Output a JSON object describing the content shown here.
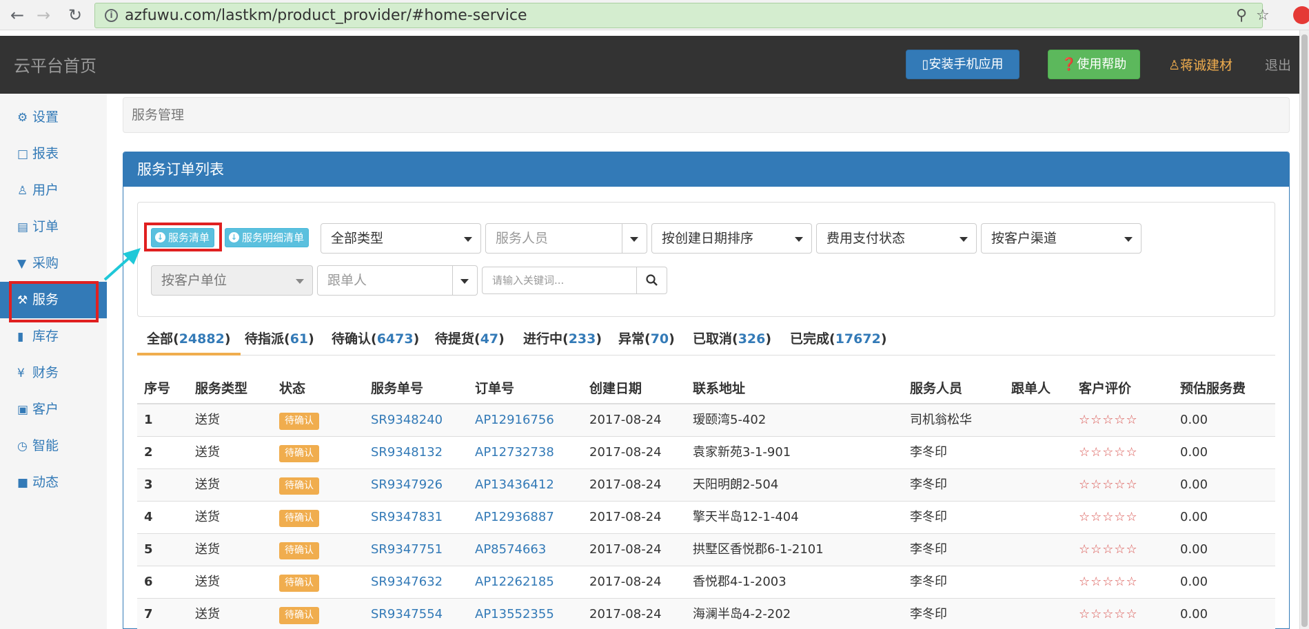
{
  "browser": {
    "url": "azfuwu.com/lastkm/product_provider/#home-service"
  },
  "header": {
    "brand": "云平台首页",
    "install_label": "安装手机应用",
    "help_label": "使用帮助",
    "user_name": "蒋诚建材",
    "logout_label": "退出"
  },
  "sidebar": {
    "items": [
      {
        "label": "设置",
        "icon": "gear-icon"
      },
      {
        "label": "报表",
        "icon": "bar-chart-icon"
      },
      {
        "label": "用户",
        "icon": "user-icon"
      },
      {
        "label": "订单",
        "icon": "list-icon"
      },
      {
        "label": "采购",
        "icon": "cart-icon"
      },
      {
        "label": "服务",
        "icon": "wrench-icon"
      },
      {
        "label": "库存",
        "icon": "barcode-icon"
      },
      {
        "label": "财务",
        "icon": "yen-icon"
      },
      {
        "label": "客户",
        "icon": "briefcase-icon"
      },
      {
        "label": "智能",
        "icon": "dashboard-icon"
      },
      {
        "label": "动态",
        "icon": "comment-icon"
      }
    ],
    "active_index": 5
  },
  "breadcrumb": "服务管理",
  "panel_title": "服务订单列表",
  "filters": {
    "btn_service_list": "服务清单",
    "btn_service_detail": "服务明细清单",
    "type": "全部类型",
    "staff": "服务人员",
    "sort": "按创建日期排序",
    "payment": "费用支付状态",
    "channel": "按客户渠道",
    "unit": "按客户单位",
    "follower": "跟单人",
    "keyword_placeholder": "请输入关键词..."
  },
  "tabs": [
    {
      "label": "全部",
      "count": "24882"
    },
    {
      "label": "待指派",
      "count": "61"
    },
    {
      "label": "待确认",
      "count": "6473"
    },
    {
      "label": "待提货",
      "count": "47"
    },
    {
      "label": "进行中",
      "count": "233"
    },
    {
      "label": "异常",
      "count": "70"
    },
    {
      "label": "已取消",
      "count": "326"
    },
    {
      "label": "已完成",
      "count": "17672"
    }
  ],
  "table": {
    "headers": [
      "序号",
      "服务类型",
      "状态",
      "服务单号",
      "订单号",
      "创建日期",
      "联系地址",
      "服务人员",
      "跟单人",
      "客户评价",
      "预估服务费"
    ],
    "rows": [
      {
        "no": "1",
        "type": "送货",
        "status": "待确认",
        "sr": "SR9348240",
        "ap": "AP12916756",
        "date": "2017-08-24",
        "addr": "瑷颐湾5-402",
        "staff": "司机翁松华",
        "follower": "",
        "rating": "☆☆☆☆☆",
        "fee": "0.00"
      },
      {
        "no": "2",
        "type": "送货",
        "status": "待确认",
        "sr": "SR9348132",
        "ap": "AP12732738",
        "date": "2017-08-24",
        "addr": "袁家新苑3-1-901",
        "staff": "李冬印",
        "follower": "",
        "rating": "☆☆☆☆☆",
        "fee": "0.00"
      },
      {
        "no": "3",
        "type": "送货",
        "status": "待确认",
        "sr": "SR9347926",
        "ap": "AP13436412",
        "date": "2017-08-24",
        "addr": "天阳明朗2-504",
        "staff": "李冬印",
        "follower": "",
        "rating": "☆☆☆☆☆",
        "fee": "0.00"
      },
      {
        "no": "4",
        "type": "送货",
        "status": "待确认",
        "sr": "SR9347831",
        "ap": "AP12936887",
        "date": "2017-08-24",
        "addr": "擎天半岛12-1-404",
        "staff": "李冬印",
        "follower": "",
        "rating": "☆☆☆☆☆",
        "fee": "0.00"
      },
      {
        "no": "5",
        "type": "送货",
        "status": "待确认",
        "sr": "SR9347751",
        "ap": "AP8574663",
        "date": "2017-08-24",
        "addr": "拱墅区香悦郡6-1-2101",
        "staff": "李冬印",
        "follower": "",
        "rating": "☆☆☆☆☆",
        "fee": "0.00"
      },
      {
        "no": "6",
        "type": "送货",
        "status": "待确认",
        "sr": "SR9347632",
        "ap": "AP12262185",
        "date": "2017-08-24",
        "addr": "香悦郡4-1-2003",
        "staff": "李冬印",
        "follower": "",
        "rating": "☆☆☆☆☆",
        "fee": "0.00"
      },
      {
        "no": "7",
        "type": "送货",
        "status": "待确认",
        "sr": "SR9347554",
        "ap": "AP13552355",
        "date": "2017-08-24",
        "addr": "海澜半岛4-2-202",
        "staff": "李冬印",
        "follower": "",
        "rating": "☆☆☆☆☆",
        "fee": "0.00"
      }
    ]
  },
  "colors": {
    "primary": "#337ab7",
    "header_bg": "#333333",
    "success": "#5cb85c",
    "warning": "#f0ad4e",
    "info": "#5bc0de",
    "highlight": "#e02020",
    "rating": "#d9534f"
  }
}
